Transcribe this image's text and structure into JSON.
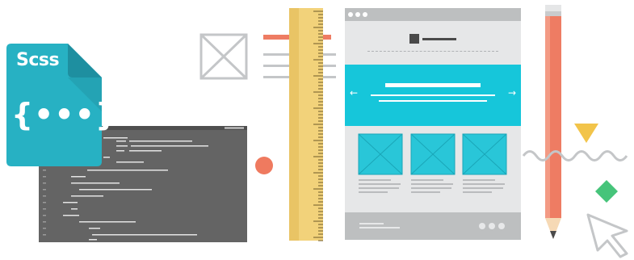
{
  "scss_icon": {
    "label": "Scss",
    "braces": "{•••}",
    "color": "#27B1C3",
    "fold_color": "#1E8FA0"
  },
  "code_editor": {
    "background": "#646464"
  },
  "wireframe_browser": {
    "prev_arrow": "←",
    "next_arrow": "→",
    "hero_color": "#16C6DA",
    "tile_color": "#29C6D8",
    "chrome_color": "#BDBFC0",
    "page_color": "#E6E7E8"
  },
  "decor": {
    "ruler_color": "#F2D27A",
    "pencil_color": "#EE7C63",
    "triangle_color": "#F2C44A",
    "diamond_color": "#46C47A",
    "dot_color": "#EF7A5F"
  }
}
